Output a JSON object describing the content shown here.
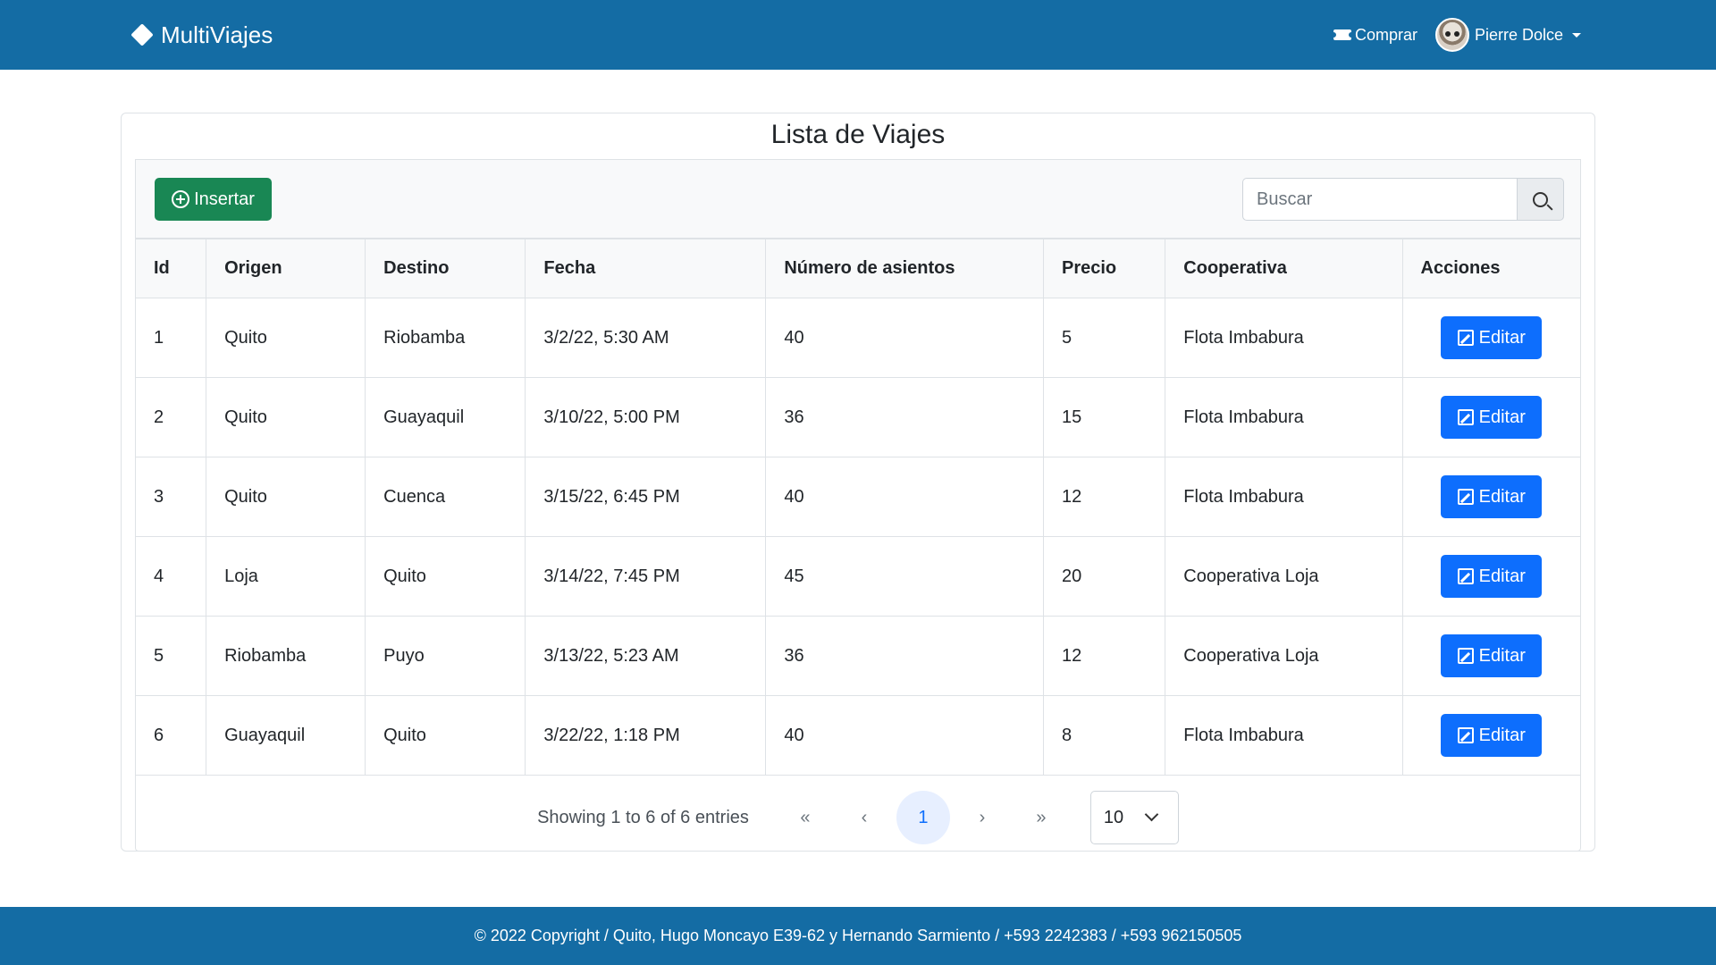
{
  "navbar": {
    "brand": "MultiViajes",
    "buy_label": "Comprar",
    "user_name": "Pierre Dolce"
  },
  "page": {
    "title": "Lista de Viajes",
    "insert_label": "Insertar",
    "search_placeholder": "Buscar"
  },
  "table": {
    "headers": [
      "Id",
      "Origen",
      "Destino",
      "Fecha",
      "Número de asientos",
      "Precio",
      "Cooperativa",
      "Acciones"
    ],
    "edit_label": "Editar",
    "rows": [
      [
        "1",
        "Quito",
        "Riobamba",
        "3/2/22, 5:30 AM",
        "40",
        "5",
        "Flota Imbabura"
      ],
      [
        "2",
        "Quito",
        "Guayaquil",
        "3/10/22, 5:00 PM",
        "36",
        "15",
        "Flota Imbabura"
      ],
      [
        "3",
        "Quito",
        "Cuenca",
        "3/15/22, 6:45 PM",
        "40",
        "12",
        "Flota Imbabura"
      ],
      [
        "4",
        "Loja",
        "Quito",
        "3/14/22, 7:45 PM",
        "45",
        "20",
        "Cooperativa Loja"
      ],
      [
        "5",
        "Riobamba",
        "Puyo",
        "3/13/22, 5:23 AM",
        "36",
        "12",
        "Cooperativa Loja"
      ],
      [
        "6",
        "Guayaquil",
        "Quito",
        "3/22/22, 1:18 PM",
        "40",
        "8",
        "Flota Imbabura"
      ]
    ]
  },
  "pagination": {
    "info": "Showing 1 to 6 of 6 entries",
    "first": "«",
    "prev": "‹",
    "current": "1",
    "next": "›",
    "last": "»",
    "rows_per_page": "10"
  },
  "footer": {
    "text": "© 2022 Copyright / Quito, Hugo Moncayo E39-62 y Hernando Sarmiento / +593 2242383 / +593 962150505"
  }
}
